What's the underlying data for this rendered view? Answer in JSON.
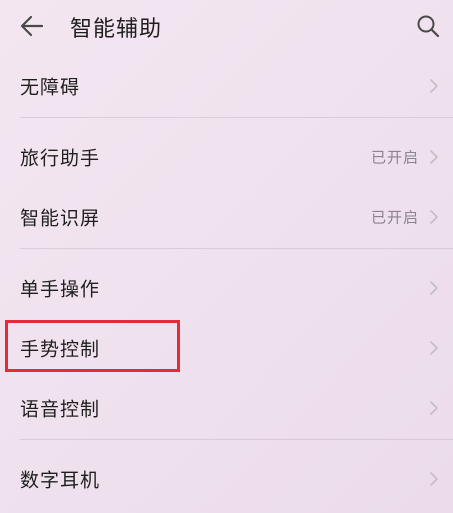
{
  "header": {
    "title": "智能辅助",
    "back_icon": "back-arrow-icon",
    "search_icon": "search-icon"
  },
  "items": [
    {
      "label": "无障碍",
      "status": ""
    },
    {
      "label": "旅行助手",
      "status": "已开启"
    },
    {
      "label": "智能识屏",
      "status": "已开启"
    },
    {
      "label": "单手操作",
      "status": ""
    },
    {
      "label": "手势控制",
      "status": ""
    },
    {
      "label": "语音控制",
      "status": ""
    },
    {
      "label": "数字耳机",
      "status": ""
    }
  ],
  "highlight": {
    "target": "手势控制",
    "color": "#e32c37"
  }
}
